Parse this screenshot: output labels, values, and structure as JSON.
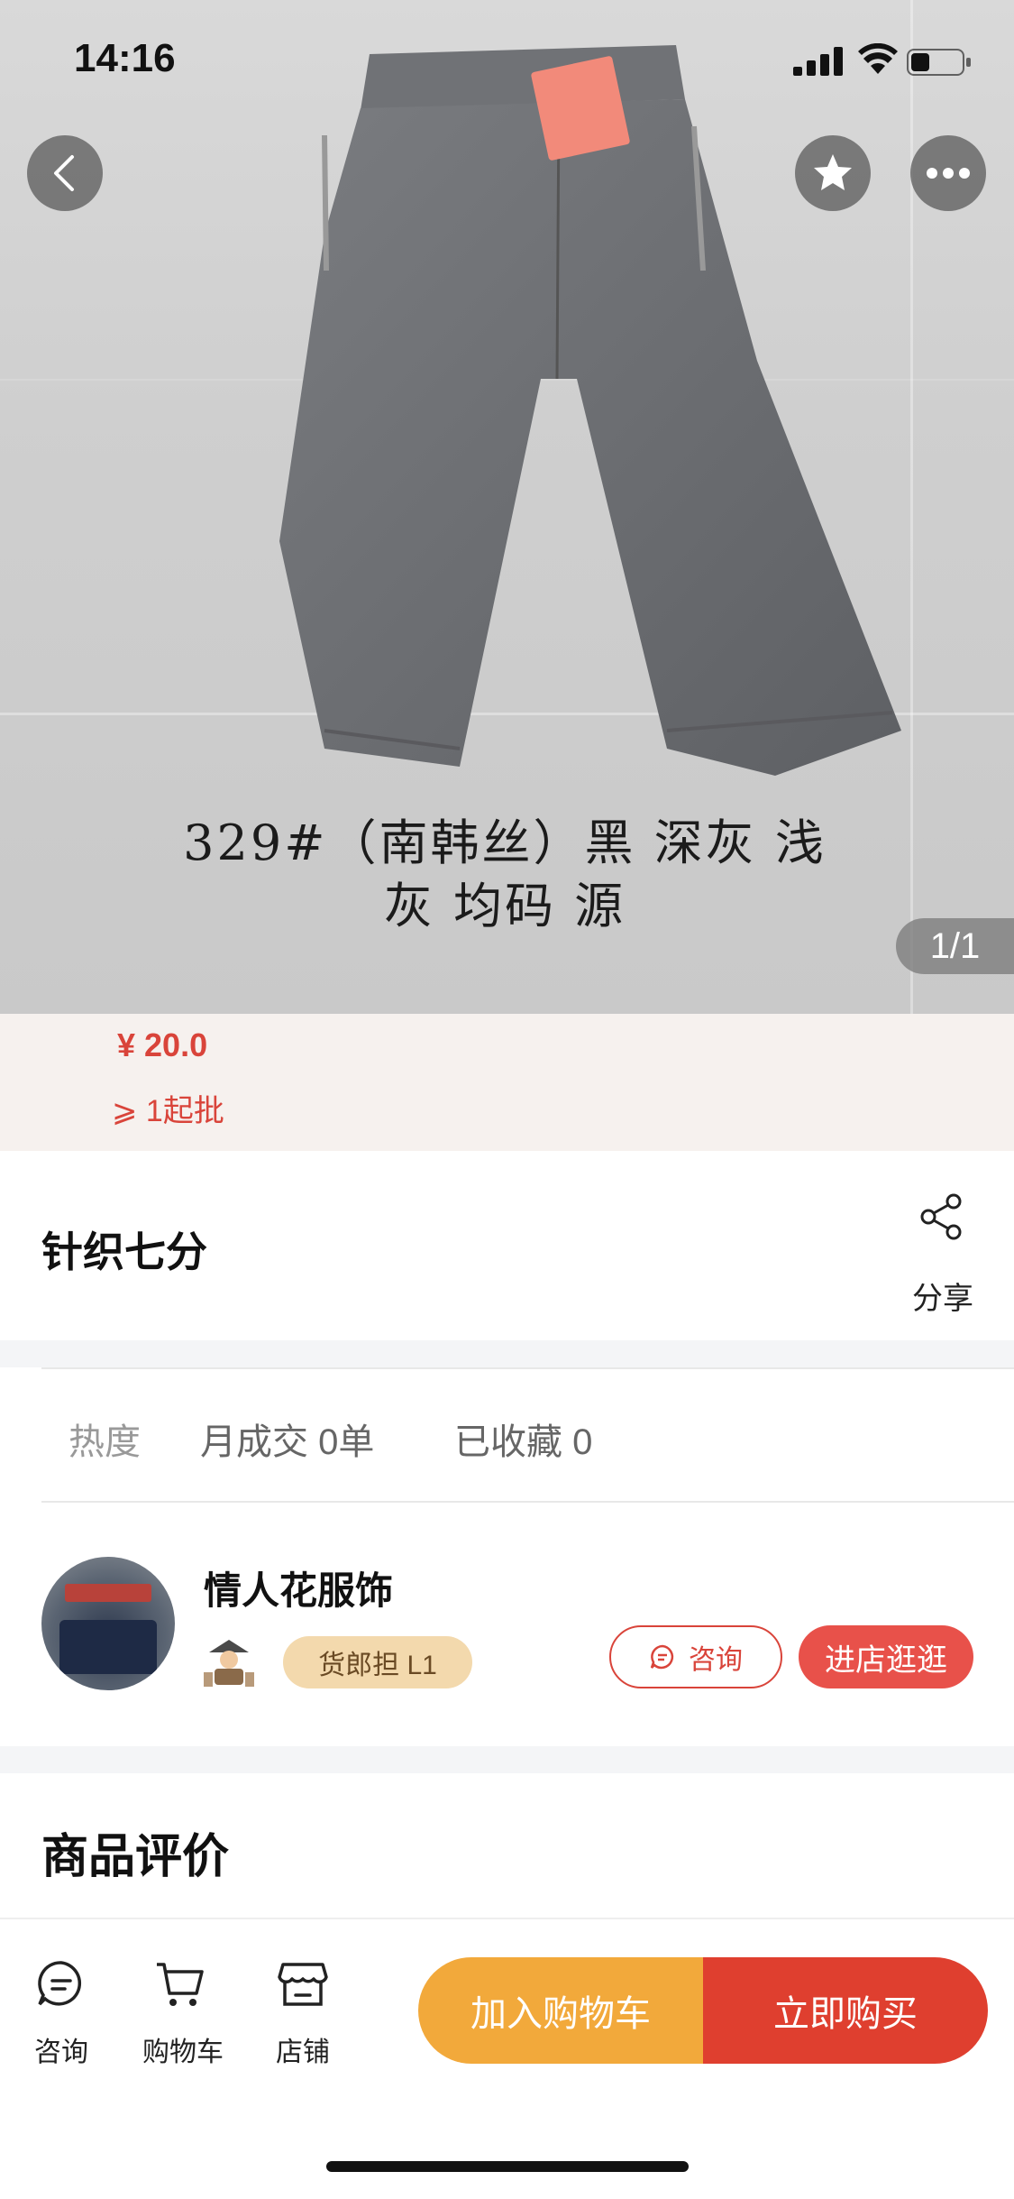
{
  "status_bar": {
    "time": "14:16"
  },
  "product": {
    "image_caption_line1": "329#（南韩丝）黑 深灰 浅",
    "image_caption_line2": "灰  均码 源",
    "page_indicator": "1/1",
    "price": "¥ 20.0",
    "min_batch": "⩾ 1起批",
    "title": "针织七分",
    "share_label": "分享"
  },
  "stats": {
    "heat_label": "热度",
    "monthly_deals": "月成交 0单",
    "favorites": "已收藏 0"
  },
  "shop": {
    "name": "情人花服饰",
    "level_badge": "货郎担 L1",
    "consult_label": "咨询",
    "enter_label": "进店逛逛"
  },
  "reviews": {
    "section_title": "商品评价"
  },
  "bottom_bar": {
    "tabs": [
      {
        "label": "咨询",
        "icon": "chat-icon"
      },
      {
        "label": "购物车",
        "icon": "cart-icon"
      },
      {
        "label": "店铺",
        "icon": "store-icon"
      }
    ],
    "add_to_cart": "加入购物车",
    "buy_now": "立即购买"
  },
  "colors": {
    "price_red": "#d9443a",
    "cart_orange": "#f2a93b",
    "buy_red": "#df3f2f",
    "badge_tan": "#f3d9ad"
  }
}
